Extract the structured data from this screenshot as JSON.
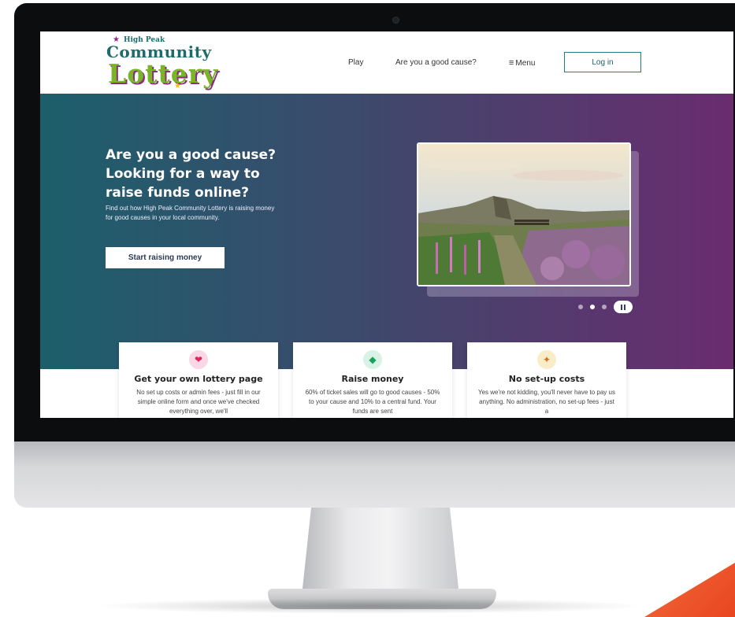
{
  "logo": {
    "line1": "High Peak",
    "line2": "Community",
    "line3": "Lottery"
  },
  "nav": {
    "play": "Play",
    "good_cause": "Are you a good cause?",
    "menu": "Menu",
    "login": "Log in"
  },
  "hero": {
    "title": "Are you a good cause? Looking for a way to raise funds online?",
    "subtitle": "Find out how High Peak Community Lottery is raising money for good causes in your local community.",
    "cta": "Start raising money"
  },
  "carousel": {
    "active_index": 1,
    "total_slides": 3,
    "state": "playing"
  },
  "cards": [
    {
      "title": "Get your own lottery page",
      "text": "No set up costs or admin fees - just fill in our simple online form and once we've checked everything over, we'll",
      "icon": "heart-icon",
      "icon_color": "#f9d7e6"
    },
    {
      "title": "Raise money",
      "text": "60% of ticket sales will go to good causes - 50% to your cause and 10% to a central fund. Your funds are sent",
      "icon": "money-icon",
      "icon_color": "#d8f3e6"
    },
    {
      "title": "No set-up costs",
      "text": "Yes we're not kidding, you'll never have to pay us anything. No administration, no set-up fees - just a",
      "icon": "party-icon",
      "icon_color": "#f8ecc9"
    }
  ],
  "colors": {
    "hero_start": "#1c5f6b",
    "hero_end": "#6a2c6f",
    "accent": "#1f7f86",
    "logo_green": "#7ab529",
    "logo_teal": "#1f6b6b"
  }
}
